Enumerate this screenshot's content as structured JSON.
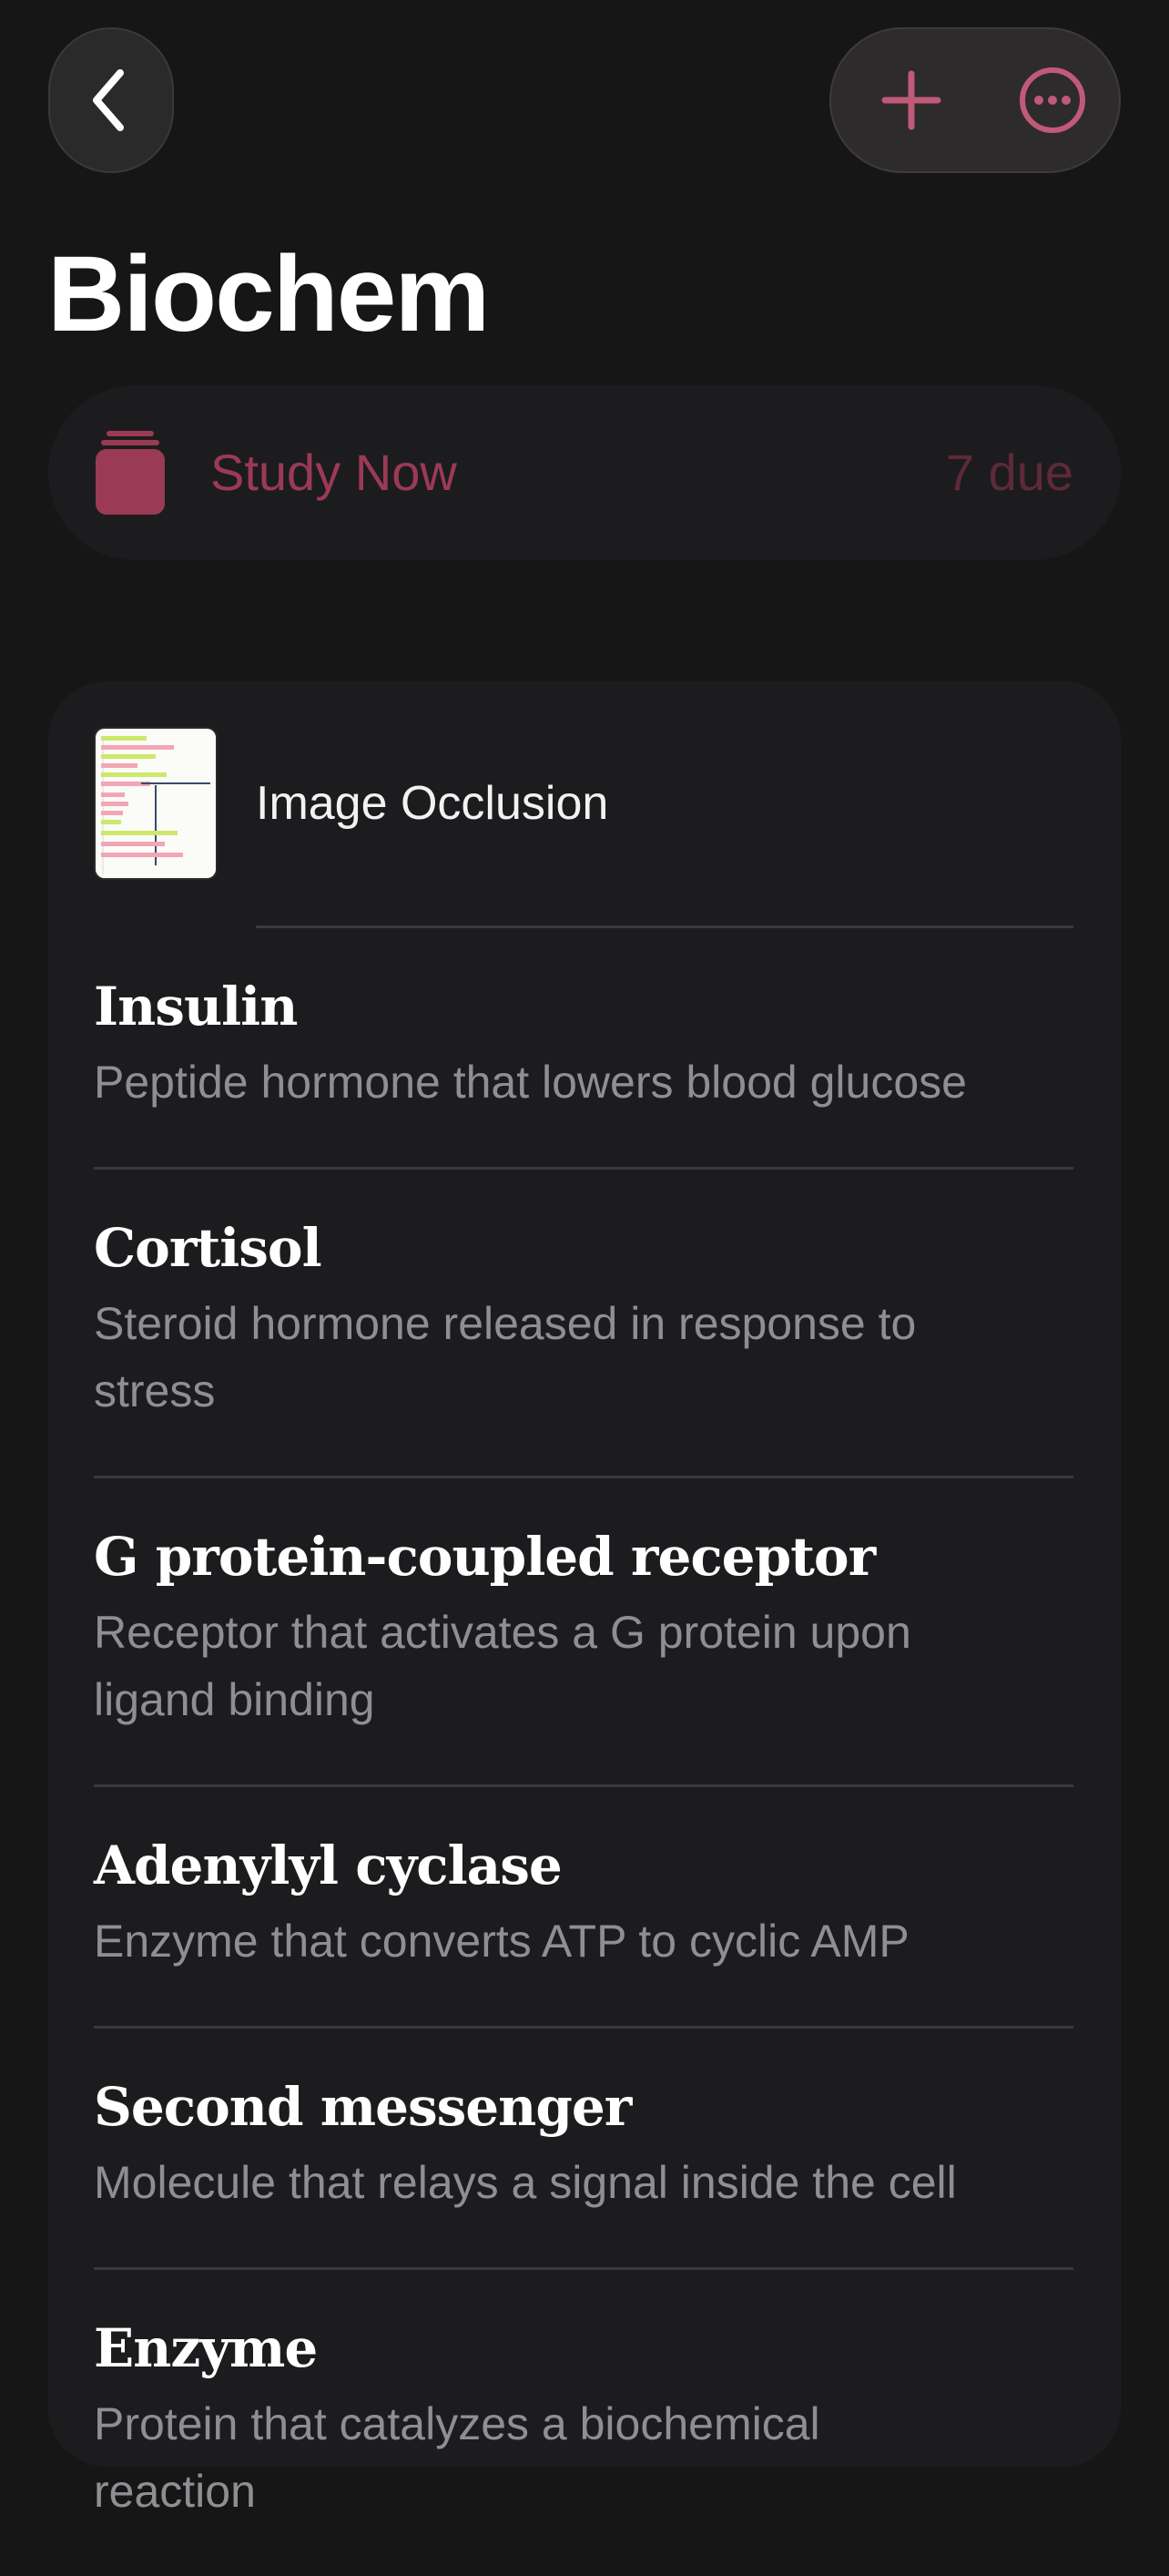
{
  "header": {
    "back_icon": "chevron-left-icon",
    "add_icon": "plus-icon",
    "more_icon": "ellipsis-circle-icon",
    "accent_color": "#c05a78"
  },
  "page_title": "Biochem",
  "study": {
    "icon": "card-stack-icon",
    "label": "Study Now",
    "due": "7 due",
    "accent_color": "#9b3a55"
  },
  "image_occlusion": {
    "label": "Image Occlusion",
    "thumb_icon": "image-occlusion-thumbnail"
  },
  "cards": [
    {
      "term": "Insulin",
      "definition": "Peptide hormone that lowers blood glucose"
    },
    {
      "term": "Cortisol",
      "definition": "Steroid hormone released in response to stress"
    },
    {
      "term": "G protein-coupled receptor",
      "definition": "Receptor that activates a G protein upon ligand binding"
    },
    {
      "term": "Adenylyl cyclase",
      "definition": "Enzyme that converts ATP to cyclic AMP"
    },
    {
      "term": "Second messenger",
      "definition": "Molecule that relays a signal inside the cell"
    },
    {
      "term": "Enzyme",
      "definition": "Protein that catalyzes a biochemical reaction"
    }
  ]
}
